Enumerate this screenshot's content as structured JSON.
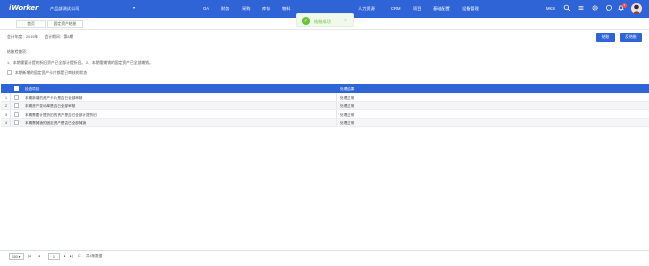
{
  "header": {
    "logo": "iWorker",
    "company": "产品部测试公司",
    "company_arrow": "▾",
    "nav": [
      "OA",
      "财务",
      "采购",
      "库存",
      "物料",
      "人力资源",
      "CRM",
      "项目",
      "基础配置",
      "设备管理"
    ],
    "user": "MKS",
    "notify_count": "4"
  },
  "toast": {
    "message": "结账成功",
    "close": "×"
  },
  "tabs": [
    "首页",
    "固定资产结账"
  ],
  "period": {
    "year_label": "会计年度：",
    "year": "2019年",
    "period_label": "会计期间：",
    "period": "第8期"
  },
  "actions": {
    "checkout": "结账",
    "reverse": "反结账"
  },
  "checks": {
    "heading": "结账检查项：",
    "note": "1、本期需要计提的折旧资产已全部计提折旧。  2、本期需摊销的固定资产已全部摊销。",
    "option": "本期新增的固定资产卡片都是已审核的状态"
  },
  "table": {
    "columns": [
      "检查项目",
      "处理结果"
    ],
    "rows": [
      {
        "no": "1",
        "item": "本期新增的资产卡片是否已全部审核",
        "result": "处理正常"
      },
      {
        "no": "2",
        "item": "本期资产变动单是否已全部审核",
        "result": "处理正常"
      },
      {
        "no": "3",
        "item": "本期需要计提折旧的资产是否已全部计提折旧",
        "result": "处理正常"
      },
      {
        "no": "4",
        "item": "本期需摊销的固定资产是否已全部摊销",
        "result": "处理正常"
      }
    ]
  },
  "pagination": {
    "page_size": "100",
    "first": "|◂",
    "prev": "◂",
    "page": "1",
    "next": "▸",
    "last": "▸|",
    "refresh": "C",
    "summary": "共4条数据"
  },
  "colors": {
    "primary": "#2f64d6",
    "success": "#67c23a",
    "badge": "#ff4d4f"
  }
}
